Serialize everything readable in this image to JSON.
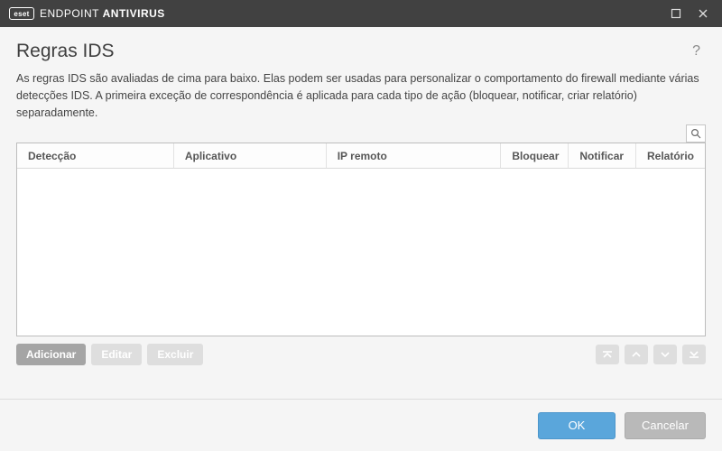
{
  "brand": {
    "badge": "eset",
    "name_light": "ENDPOINT ",
    "name_bold": "ANTIVIRUS"
  },
  "page": {
    "title": "Regras IDS",
    "description": "As regras IDS são avaliadas de cima para baixo. Elas podem ser usadas para personalizar o comportamento do firewall mediante várias detecções IDS. A primeira exceção de correspondência é aplicada para cada tipo de ação (bloquear, notificar, criar relatório) separadamente."
  },
  "table": {
    "columns": {
      "detection": "Detecção",
      "application": "Aplicativo",
      "remote_ip": "IP remoto",
      "block": "Bloquear",
      "notify": "Notificar",
      "report": "Relatório"
    },
    "rows": []
  },
  "actions": {
    "add": "Adicionar",
    "edit": "Editar",
    "delete": "Excluir"
  },
  "footer": {
    "ok": "OK",
    "cancel": "Cancelar"
  }
}
